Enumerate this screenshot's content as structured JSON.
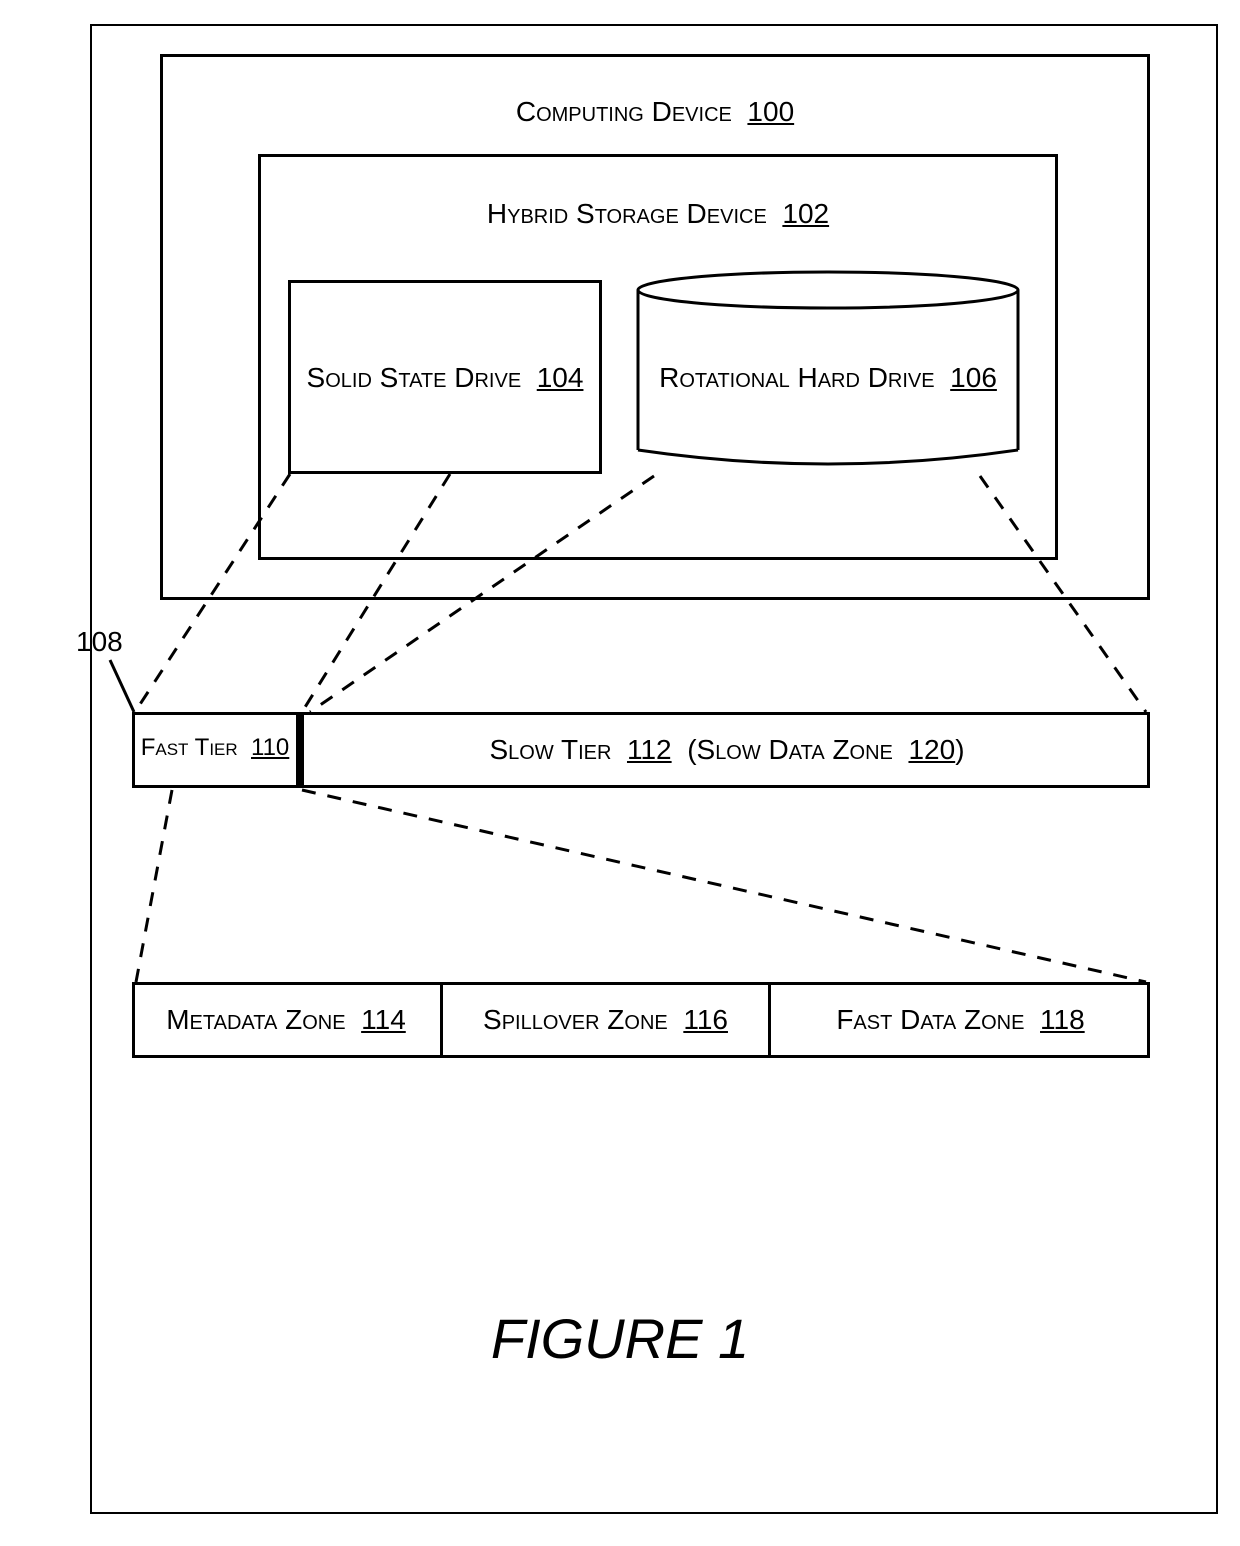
{
  "figure_title": "FIGURE 1",
  "callout_108": "108",
  "computing_device": {
    "label": "Computing Device",
    "ref": "100"
  },
  "hybrid_storage": {
    "label": "Hybrid Storage Device",
    "ref": "102"
  },
  "ssd": {
    "label": "Solid State Drive",
    "ref": "104"
  },
  "hdd": {
    "label": "Rotational Hard Drive",
    "ref": "106"
  },
  "fast_tier": {
    "label": "Fast Tier",
    "ref": "110"
  },
  "slow_tier": {
    "label_prefix": "Slow Tier",
    "ref": "112",
    "paren_prefix": "(Slow Data Zone",
    "paren_ref": "120",
    "paren_suffix": ")"
  },
  "metadata_zone": {
    "label": "Metadata Zone",
    "ref": "114"
  },
  "spillover_zone": {
    "label": "Spillover Zone",
    "ref": "116"
  },
  "fast_data_zone": {
    "label": "Fast Data Zone",
    "ref": "118"
  }
}
